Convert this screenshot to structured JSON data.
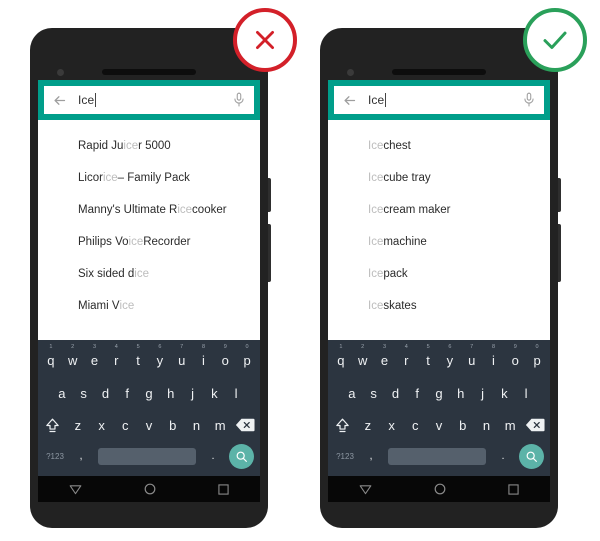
{
  "colors": {
    "header_teal": "#009e8a",
    "keyboard_bg": "#2c3540",
    "spacebar": "#55606c",
    "search_key_teal": "#5cb3a8",
    "badge_bad": "#d32029",
    "badge_good": "#2aa05a",
    "phone_body": "#222222",
    "match_highlight": "#bdbdbd",
    "text_dark": "#2b2b2b"
  },
  "badges": {
    "bad": {
      "icon": "x-mark-icon",
      "label": "X"
    },
    "good": {
      "icon": "check-mark-icon",
      "label": "✓"
    }
  },
  "phones": [
    {
      "id": "bad-example",
      "search": {
        "value": "Ice",
        "back_icon": "back-arrow-icon",
        "mic_icon": "microphone-icon"
      },
      "suggestions": [
        [
          {
            "t": "Rapid Ju",
            "m": false
          },
          {
            "t": "ice",
            "m": true
          },
          {
            "t": "r 5000",
            "m": false
          }
        ],
        [
          {
            "t": "Licor",
            "m": false
          },
          {
            "t": "ice",
            "m": true
          },
          {
            "t": " – Family Pack",
            "m": false
          }
        ],
        [
          {
            "t": "Manny's Ultimate R",
            "m": false
          },
          {
            "t": "ice",
            "m": true
          },
          {
            "t": " cooker",
            "m": false
          }
        ],
        [
          {
            "t": "Philips Vo",
            "m": false
          },
          {
            "t": "ice",
            "m": true
          },
          {
            "t": " Recorder",
            "m": false
          }
        ],
        [
          {
            "t": "Six sided d",
            "m": false
          },
          {
            "t": "ice",
            "m": true
          }
        ],
        [
          {
            "t": "Miami V",
            "m": false
          },
          {
            "t": "ice",
            "m": true
          }
        ]
      ]
    },
    {
      "id": "good-example",
      "search": {
        "value": "Ice",
        "back_icon": "back-arrow-icon",
        "mic_icon": "microphone-icon"
      },
      "suggestions": [
        [
          {
            "t": "Ice",
            "m": true
          },
          {
            "t": " chest",
            "m": false
          }
        ],
        [
          {
            "t": "Ice",
            "m": true
          },
          {
            "t": " cube tray",
            "m": false
          }
        ],
        [
          {
            "t": "Ice",
            "m": true
          },
          {
            "t": " cream maker",
            "m": false
          }
        ],
        [
          {
            "t": "Ice",
            "m": true
          },
          {
            "t": " machine",
            "m": false
          }
        ],
        [
          {
            "t": "Ice",
            "m": true
          },
          {
            "t": " pack",
            "m": false
          }
        ],
        [
          {
            "t": "Ice",
            "m": true
          },
          {
            "t": " skates",
            "m": false
          }
        ]
      ]
    }
  ],
  "keyboard": {
    "row1": [
      {
        "key": "q",
        "num": "1"
      },
      {
        "key": "w",
        "num": "2"
      },
      {
        "key": "e",
        "num": "3"
      },
      {
        "key": "r",
        "num": "4"
      },
      {
        "key": "t",
        "num": "5"
      },
      {
        "key": "y",
        "num": "6"
      },
      {
        "key": "u",
        "num": "7"
      },
      {
        "key": "i",
        "num": "8"
      },
      {
        "key": "o",
        "num": "9"
      },
      {
        "key": "p",
        "num": "0"
      }
    ],
    "row2": [
      "a",
      "s",
      "d",
      "f",
      "g",
      "h",
      "j",
      "k",
      "l"
    ],
    "row3": [
      "z",
      "x",
      "c",
      "v",
      "b",
      "n",
      "m"
    ],
    "shift_icon": "shift-icon",
    "backspace_icon": "backspace-icon",
    "symbols_label": "?123",
    "comma_label": ",",
    "period_label": ".",
    "space_label": "",
    "search_icon": "search-icon"
  },
  "navbar": {
    "back_icon": "nav-back-triangle-icon",
    "home_icon": "nav-home-circle-icon",
    "recents_icon": "nav-recents-square-icon"
  }
}
